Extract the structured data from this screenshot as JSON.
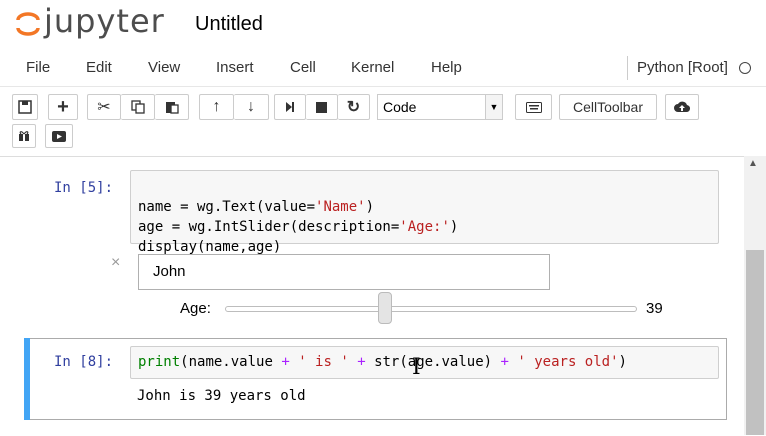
{
  "header": {
    "logo_text": "jupyter",
    "notebook_name": "Untitled"
  },
  "menu": {
    "items": [
      "File",
      "Edit",
      "View",
      "Insert",
      "Cell",
      "Kernel",
      "Help"
    ],
    "kernel_name": "Python [Root]"
  },
  "toolbar": {
    "cell_type": "Code",
    "celltoolbar_label": "CellToolbar",
    "icons": [
      "save-icon",
      "plus-icon",
      "scissors-icon",
      "copy-icon",
      "paste-icon",
      "arrow-up-icon",
      "arrow-down-icon",
      "step-icon",
      "stop-icon",
      "restart-icon",
      "keyboard-icon",
      "upload-icon",
      "gift-icon",
      "youtube-icon"
    ]
  },
  "cell1": {
    "prompt": "In [5]:",
    "line1_a": "name = wg.Text(value=",
    "line1_s": "'Name'",
    "line1_b": ")",
    "line2_a": "age = wg.IntSlider(description=",
    "line2_s": "'Age:'",
    "line2_b": ")",
    "line3": "display(name,age)"
  },
  "widgets": {
    "close_glyph": "×",
    "text_value": "John",
    "slider_label": "Age:",
    "slider_value": "39",
    "slider_fraction": 0.39
  },
  "cell2": {
    "prompt": "In [8]:",
    "kw": "print",
    "p1": "(name.value ",
    "op1": "+",
    "sp1": " ",
    "s1": "' is '",
    "sp2": " ",
    "op2": "+",
    "p2": " str(age.value) ",
    "op3": "+",
    "sp3": " ",
    "s2": "' years old'",
    "p3": ")",
    "output": "John is 39 years old"
  }
}
